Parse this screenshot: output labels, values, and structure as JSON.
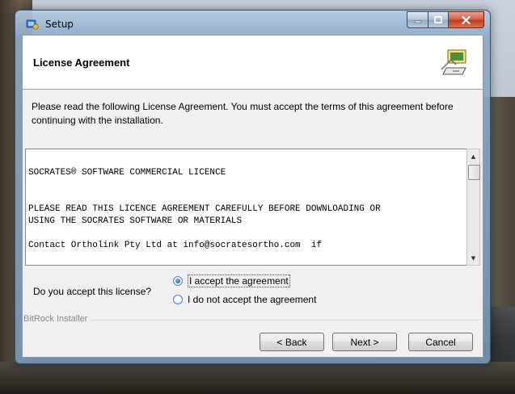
{
  "window": {
    "title": "Setup"
  },
  "header": {
    "title": "License Agreement",
    "logo_icon": "bitrock-installer-logo-icon"
  },
  "intro_text": "Please read the following License Agreement. You must accept the terms of this agreement before continuing with the installation.",
  "license": {
    "text": "SOCRATES® SOFTWARE COMMERCIAL LICENCE\n\n\nPLEASE READ THIS LICENCE AGREEMENT CAREFULLY BEFORE DOWNLOADING OR\nUSING THE SOCRATES SOFTWARE OR MATERIALS\n\nContact Ortholink Pty Ltd at info@socratesortho.com  if"
  },
  "accept": {
    "question": "Do you accept this license?",
    "options": [
      {
        "label": "I accept the agreement",
        "selected": true
      },
      {
        "label": "I do not accept the agreement",
        "selected": false
      }
    ]
  },
  "footer": {
    "group_label": "BitRock Installer",
    "back_label": "< Back",
    "next_label": "Next >",
    "cancel_label": "Cancel"
  },
  "colors": {
    "title_bar": "#9cb6d2",
    "close_button": "#c2381f",
    "radio_checked": "#1a57a8"
  }
}
